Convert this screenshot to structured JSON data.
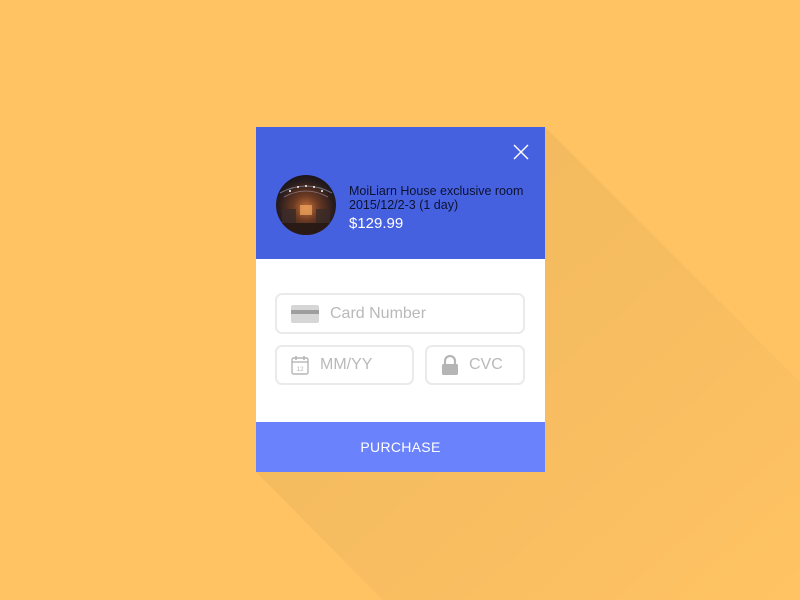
{
  "checkout": {
    "item_name": "MoiLiarn House exclusive room",
    "item_dates": "2015/12/2-3 (1 day)",
    "price": "$129.99",
    "thumbnail_icon": "room-photo",
    "close_icon": "close-icon"
  },
  "form": {
    "card_number_placeholder": "Card Number",
    "card_number_value": "",
    "expiry_placeholder": "MM/YY",
    "expiry_value": "",
    "expiry_icon_day": "12",
    "cvc_placeholder": "CVC",
    "cvc_value": ""
  },
  "actions": {
    "purchase_label": "PURCHASE"
  },
  "colors": {
    "background": "#ffc363",
    "header": "#4661e0",
    "button": "#6a82fb",
    "field_border": "#eaeaea",
    "placeholder": "#b9b9b9"
  }
}
